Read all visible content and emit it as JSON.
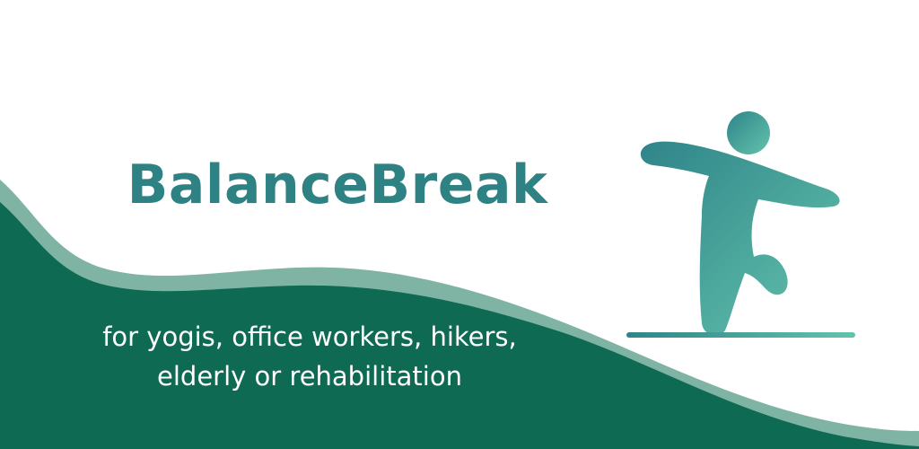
{
  "app": {
    "title": "BalanceBreak"
  },
  "tagline": {
    "line1": "for yogis, office workers, hikers,",
    "line2": "elderly or rehabilitation"
  },
  "colors": {
    "title": "#2e8284",
    "wave_dark": "#0e6a53",
    "wave_light": "#7fb3a3",
    "figure_start": "#2f8489",
    "figure_end": "#63c3ac",
    "tagline": "#ffffff"
  },
  "icons": {
    "logo": "balancing-person-icon"
  }
}
